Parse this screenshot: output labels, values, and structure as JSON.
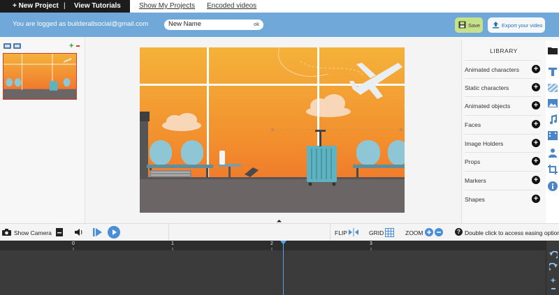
{
  "nav": {
    "new_project": "+ New Project",
    "separator": "|",
    "view_tutorials": "View Tutorials",
    "show_projects": "Show My Projects",
    "encoded_videos": "Encoded videos"
  },
  "header": {
    "logged_in": "You are logged as builderallsocial@gmail.com",
    "project_name": "New Name",
    "ok": "ok",
    "save": "Save",
    "export": "Export your video"
  },
  "library": {
    "title": "LIBRARY",
    "items": [
      {
        "label": "Animated characters"
      },
      {
        "label": "Static characters"
      },
      {
        "label": "Animated objects"
      },
      {
        "label": "Faces"
      },
      {
        "label": "Image Holders"
      },
      {
        "label": "Props"
      },
      {
        "label": "Markers"
      },
      {
        "label": "Shapes"
      }
    ],
    "plus_glyph": "+"
  },
  "toolbar": {
    "show_camera": "Show Camera",
    "flip": "FLIP",
    "grid": "GRID",
    "zoom": "ZOOM",
    "hint": "Double click to access easing options",
    "help_glyph": "?"
  },
  "timeline": {
    "ticks": [
      "0",
      "1",
      "2",
      "3"
    ]
  },
  "colors": {
    "header_blue": "#6fa8d9",
    "save_green": "#c6e18a",
    "sky_top": "#f4b23a",
    "sky_bottom": "#ef6a2a",
    "floor": "#6b6565",
    "seat": "#8fc6d6",
    "timeline": "#3b3b3b",
    "playhead": "#5aa0e6"
  }
}
